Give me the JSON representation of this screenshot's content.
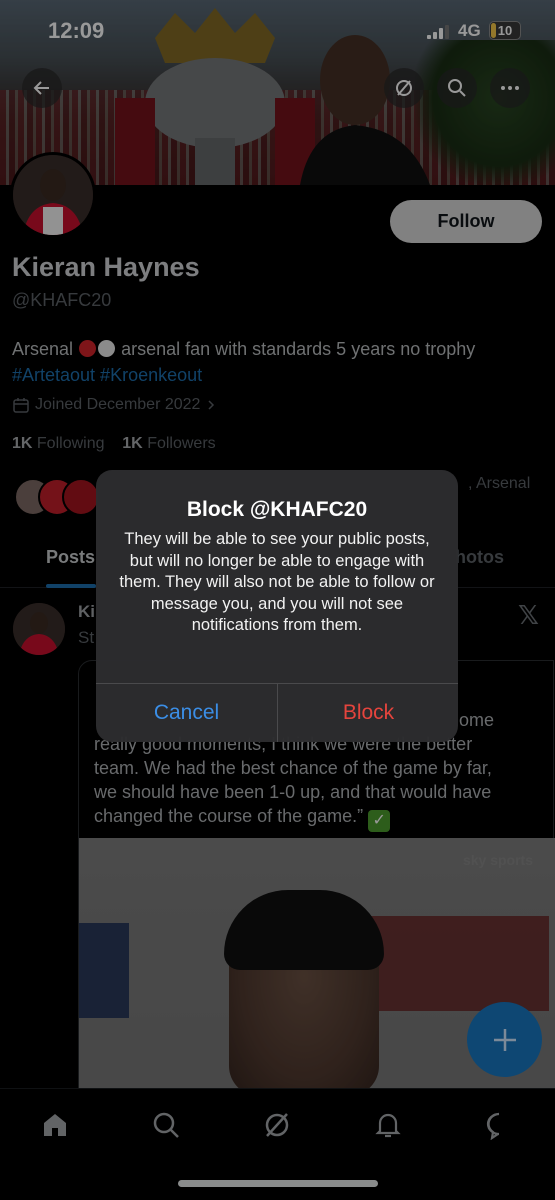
{
  "status_bar": {
    "time": "12:09",
    "network": "4G",
    "battery": "10"
  },
  "profile": {
    "name": "Kieran Haynes",
    "handle": "@KHAFC20",
    "follow_label": "Follow",
    "bio_prefix": "Arsenal",
    "bio_text": "arsenal fan with standards 5 years no trophy",
    "bio_hashtags": "#Artetaout #Kroenkeout",
    "joined": "Joined December 2022",
    "following_count": "1K",
    "following_label": "Following",
    "followers_count": "1K",
    "followers_label": "Followers",
    "followed_by_text": ", Arsenal"
  },
  "tabs": [
    {
      "label": "Posts",
      "active": true
    },
    {
      "label": "hotos",
      "active": false
    }
  ],
  "tweet": {
    "name": "Ki",
    "sub": "St",
    "quote_lines": [
      "ome",
      "really good moments, I think we were the better",
      "team. We had the best chance of the game by far,",
      "we should have been 1-0 up, and that would have",
      "changed the course of the game.”"
    ],
    "photo_watermark": "sky sports"
  },
  "dialog": {
    "title": "Block @KHAFC20",
    "message": "They will be able to see your public posts, but will no longer be able to engage with them. They will also not be able to follow or message you, and you will not see notifications from them.",
    "cancel_label": "Cancel",
    "block_label": "Block"
  },
  "colors": {
    "accent": "#1d9bf0",
    "destructive": "#e5443d",
    "cancel": "#3b8ee6"
  },
  "nav_icons": [
    "home-icon",
    "search-icon",
    "grok-icon",
    "bell-icon",
    "messages-icon"
  ]
}
